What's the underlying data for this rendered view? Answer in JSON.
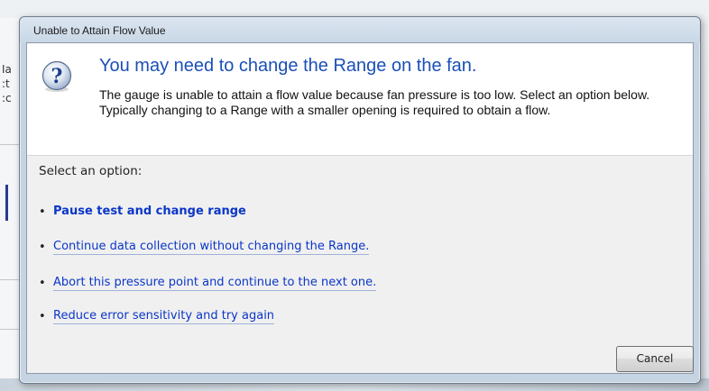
{
  "background": {
    "fragments": [
      "Ia",
      ":t",
      ":c"
    ]
  },
  "dialog": {
    "title": "Unable to Attain Flow Value",
    "icon": "question-mark-icon",
    "main_instruction": "You may need to change the Range on the fan.",
    "content": "The gauge is unable to attain a flow value because fan pressure is too low.  Select an option below. Typically changing to a Range with a smaller opening is required to obtain a flow.",
    "select_label": "Select an option:",
    "options": [
      {
        "label": "Pause test and change range",
        "bold": true
      },
      {
        "label": "Continue data collection without changing the Range.",
        "bold": false
      },
      {
        "label": "Abort this pressure point and continue to the next one.",
        "bold": false
      },
      {
        "label": "Reduce error sensitivity and try again",
        "bold": false
      }
    ],
    "cancel_label": "Cancel",
    "colors": {
      "main_instruction": "#1b4fb7",
      "link": "#0b36c8",
      "frame": "#c5d3e2"
    }
  }
}
